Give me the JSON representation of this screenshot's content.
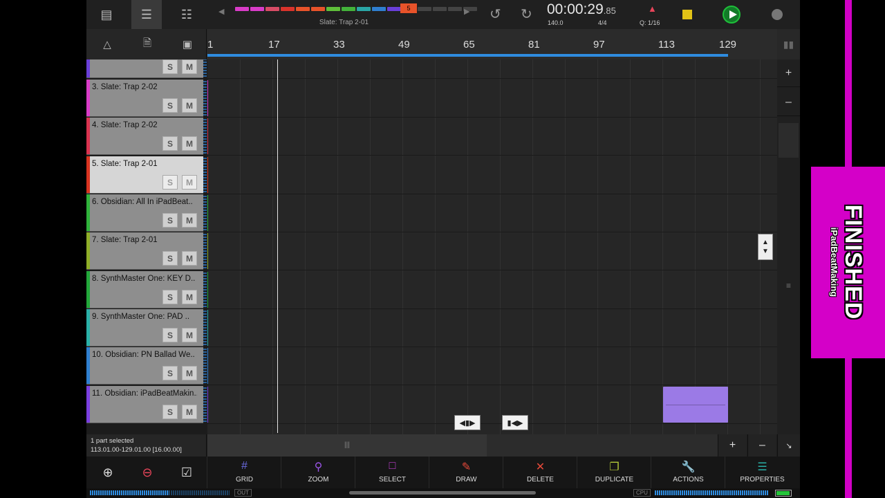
{
  "toolbar": {
    "song_name": "Slate: Trap 2-01",
    "current_part": "5",
    "part_colors": [
      "#d93cc8",
      "#d93cc8",
      "#d94c66",
      "#d9332b",
      "#e8532a",
      "#e8532a",
      "#5fbf3a",
      "#43b23a",
      "#2aa6a6",
      "#2f7fd0",
      "#6a3fd9",
      "#444",
      "#444",
      "#444",
      "#444",
      "#444"
    ]
  },
  "transport": {
    "time_main": "00:00:29",
    "time_frac": ".85",
    "tempo": "140.0",
    "meter": "4/4",
    "quantize": "Q: 1/16"
  },
  "ruler": {
    "labels": [
      "1",
      "17",
      "33",
      "49",
      "65",
      "81",
      "97",
      "113",
      "129"
    ]
  },
  "tracks": [
    {
      "name": "",
      "color": "#6a3fd9",
      "selected": false,
      "partial": true
    },
    {
      "name": "3. Slate: Trap 2-02",
      "color": "#d93cc8",
      "selected": false
    },
    {
      "name": "4. Slate: Trap 2-02",
      "color": "#d9334f",
      "selected": false
    },
    {
      "name": "5. Slate: Trap 2-01",
      "color": "#d9331f",
      "selected": true
    },
    {
      "name": "6. Obsidian: All In iPadBeat..",
      "color": "#2fb23a",
      "selected": false
    },
    {
      "name": "7. Slate: Trap 2-01",
      "color": "#8fae28",
      "selected": false
    },
    {
      "name": "8. SynthMaster One: KEY D..",
      "color": "#22a83a",
      "selected": false
    },
    {
      "name": "9. SynthMaster One: PAD ..",
      "color": "#2ab0a8",
      "selected": false
    },
    {
      "name": "10. Obsidian: PN Ballad We..",
      "color": "#2f7fd0",
      "selected": false
    },
    {
      "name": "11. Obsidian: iPadBeatMakin..",
      "color": "#7a3fe0",
      "selected": false
    }
  ],
  "track_buttons": {
    "solo": "S",
    "mute": "M"
  },
  "status": {
    "line1": "1 part selected",
    "line2": "113.01.00-129.01.00 [16.00.00]"
  },
  "tools": [
    {
      "label": "GRID",
      "icon": "grid-icon",
      "color": "#6a6adf"
    },
    {
      "label": "ZOOM",
      "icon": "zoom-icon",
      "color": "#9a55e6"
    },
    {
      "label": "SELECT",
      "icon": "select-icon",
      "color": "#c13fd0"
    },
    {
      "label": "DRAW",
      "icon": "draw-icon",
      "color": "#e84a3a"
    },
    {
      "label": "DELETE",
      "icon": "delete-icon",
      "color": "#e84a3a"
    },
    {
      "label": "DUPLICATE",
      "icon": "duplicate-icon",
      "color": "#b2c93a"
    },
    {
      "label": "ACTIONS",
      "icon": "actions-icon",
      "color": "#2fbf3a"
    },
    {
      "label": "PROPERTIES",
      "icon": "properties-icon",
      "color": "#2ab0a8"
    }
  ],
  "meters": {
    "out_label": "OUT",
    "cpu_label": "CPU"
  },
  "banner": {
    "title": "FINISHED",
    "subtitle": "iPadBeatMaking"
  }
}
